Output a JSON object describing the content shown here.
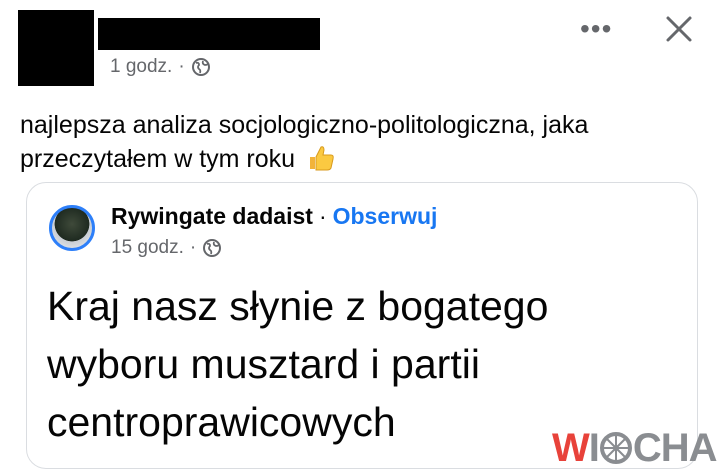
{
  "post": {
    "time": "1 godz.",
    "separator": "·",
    "text": "najlepsza analiza socjologiczno-politologiczna, jaka przeczytałem w tym roku"
  },
  "header_actions": {
    "more_label": "•••",
    "close_icon": "close-icon"
  },
  "shared_post": {
    "author": "Rywingate dadaist",
    "separator": "·",
    "follow_label": "Obserwuj",
    "time": "15 godz.",
    "meta_separator": "·",
    "text": "Kraj nasz słynie z bogatego wyboru musztard i partii centroprawicowych"
  },
  "watermark": {
    "first": "W",
    "second": "I",
    "third": "CHA"
  },
  "colors": {
    "link": "#1877f2",
    "meta": "#65676b",
    "watermark_red": "#e8423a",
    "watermark_gray": "#8a8d91"
  }
}
